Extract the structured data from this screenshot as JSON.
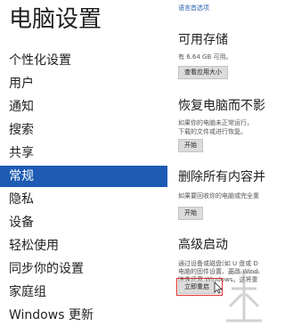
{
  "sidebar": {
    "title": "电脑设置",
    "items": [
      {
        "label": "个性化设置"
      },
      {
        "label": "用户"
      },
      {
        "label": "通知"
      },
      {
        "label": "搜索"
      },
      {
        "label": "共享"
      },
      {
        "label": "常规",
        "selected": true
      },
      {
        "label": "隐私"
      },
      {
        "label": "设备"
      },
      {
        "label": "轻松使用"
      },
      {
        "label": "同步你的设置"
      },
      {
        "label": "家庭组"
      },
      {
        "label": "Windows 更新"
      }
    ]
  },
  "main": {
    "language_link": "语言首选项",
    "storage": {
      "title": "可用存储",
      "text": "有 6.64 GB 可用。",
      "button": "查看应用大小"
    },
    "refresh": {
      "title": "恢复电脑而不影",
      "text_line1": "如果你的电脑未正常运行，",
      "text_line2": "下载的文件或进行恢复。",
      "button": "开始"
    },
    "reset": {
      "title": "删除所有内容并",
      "text": "如果要回收你的电脑或完全重",
      "button": "开始"
    },
    "advanced": {
      "title": "高级启动",
      "text_line1": "通过设备或磁盘(如 U 盘或 D",
      "text_line2": "电脑的固件设置、更改 Wind",
      "text_line3": "映像还原 Windows。这将重",
      "button": "立即重启"
    }
  },
  "colors": {
    "accent": "#1d5bb4",
    "highlight": "#e03030"
  },
  "icons": {
    "cursor": "mouse-pointer-icon",
    "watermark": "watermark-logo"
  }
}
